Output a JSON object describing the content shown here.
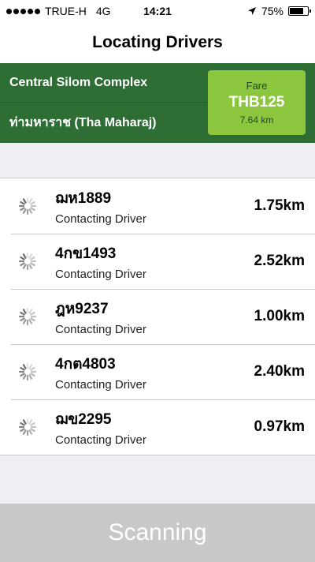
{
  "status_bar": {
    "carrier": "TRUE-H",
    "network": "4G",
    "time": "14:21",
    "battery_percent": "75%",
    "battery_level": 0.75,
    "location_icon": "location-arrow-icon"
  },
  "nav": {
    "title": "Locating Drivers"
  },
  "route": {
    "origin": "Central Silom Complex",
    "destination": "ท่ามหาราช (Tha Maharaj)"
  },
  "fare": {
    "label": "Fare",
    "amount": "THB125",
    "distance": "7.64 km"
  },
  "drivers": [
    {
      "plate": "ฌห1889",
      "status": "Contacting Driver",
      "distance": "1.75km"
    },
    {
      "plate": "4กข1493",
      "status": "Contacting Driver",
      "distance": "2.52km"
    },
    {
      "plate": "ฎห9237",
      "status": "Contacting Driver",
      "distance": "1.00km"
    },
    {
      "plate": "4กต4803",
      "status": "Contacting Driver",
      "distance": "2.40km"
    },
    {
      "plate": "ฌข2295",
      "status": "Contacting Driver",
      "distance": "0.97km"
    }
  ],
  "scan_button": {
    "label": "Scanning"
  },
  "colors": {
    "header_green": "#2e6e35",
    "fare_green": "#8cc63f",
    "scan_bar": "#c8c8c8"
  }
}
